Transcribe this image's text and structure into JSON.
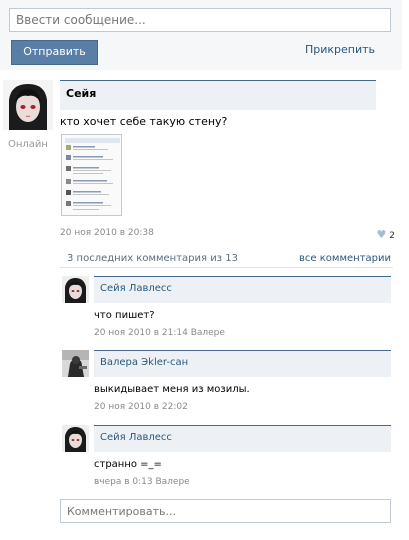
{
  "composer": {
    "placeholder": "Ввести сообщение...",
    "send_label": "Отправить",
    "attach_label": "Прикрепить"
  },
  "post": {
    "author": "Сейя",
    "status": "Онлайн",
    "text": "кто хочет себе такую стену?",
    "date": "20 ноя 2010 в 20:38",
    "likes": "2"
  },
  "comments_header": {
    "count_text": "3 последних комментария из 13",
    "all_link": "все комментарии"
  },
  "comments": [
    {
      "name": "Сейя Лавлесс",
      "text": "что пишет?",
      "meta": "20 ноя 2010 в 21:14 Валере"
    },
    {
      "name": "Валера Эkler-сан",
      "text": "выкидывает меня из мозилы.",
      "meta": "20 ноя 2010 в 22:02"
    },
    {
      "name": "Сейя Лавлесс",
      "text": "странно =_=",
      "meta": "вчера в 0:13 Валере"
    }
  ],
  "comment_box": {
    "placeholder": "Комментировать..."
  }
}
